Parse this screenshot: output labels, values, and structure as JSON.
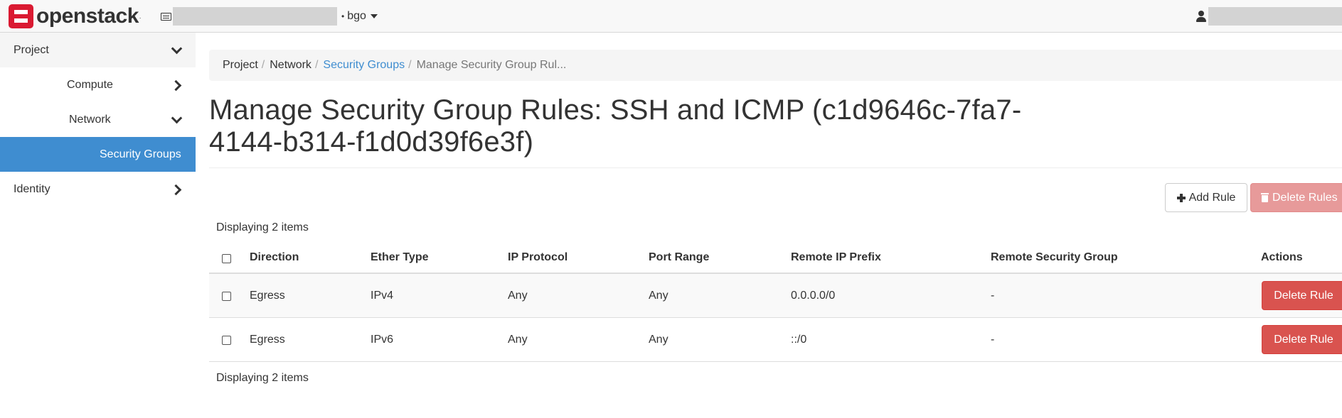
{
  "brand": {
    "name": "openstack",
    "tm": "."
  },
  "topbar": {
    "domain_label": "bgo"
  },
  "sidebar": {
    "items": [
      {
        "label": "Project"
      },
      {
        "label": "Compute"
      },
      {
        "label": "Network"
      },
      {
        "label": "Security Groups"
      },
      {
        "label": "Identity"
      }
    ]
  },
  "breadcrumb": {
    "items": [
      "Project",
      "Network",
      "Security Groups",
      "Manage Security Group Rul..."
    ],
    "separator": "/"
  },
  "page": {
    "title_line1": "Manage Security Group Rules: SSH and ICMP (c1d9646c-7fa7-",
    "title_line2": "4144-b314-f1d0d39f6e3f)"
  },
  "actions": {
    "add_rule": "Add Rule",
    "delete_rules": "Delete Rules"
  },
  "table": {
    "count_top": "Displaying 2 items",
    "count_bottom": "Displaying 2 items",
    "columns": [
      "Direction",
      "Ether Type",
      "IP Protocol",
      "Port Range",
      "Remote IP Prefix",
      "Remote Security Group",
      "Actions"
    ],
    "rows": [
      {
        "direction": "Egress",
        "ether_type": "IPv4",
        "ip_protocol": "Any",
        "port_range": "Any",
        "remote_ip_prefix": "0.0.0.0/0",
        "remote_security_group": "-",
        "action": "Delete Rule"
      },
      {
        "direction": "Egress",
        "ether_type": "IPv6",
        "ip_protocol": "Any",
        "port_range": "Any",
        "remote_ip_prefix": "::/0",
        "remote_security_group": "-",
        "action": "Delete Rule"
      }
    ]
  },
  "colors": {
    "accent": "#3f8dd0",
    "danger": "#d9534f",
    "brand_red": "#da1a32"
  }
}
